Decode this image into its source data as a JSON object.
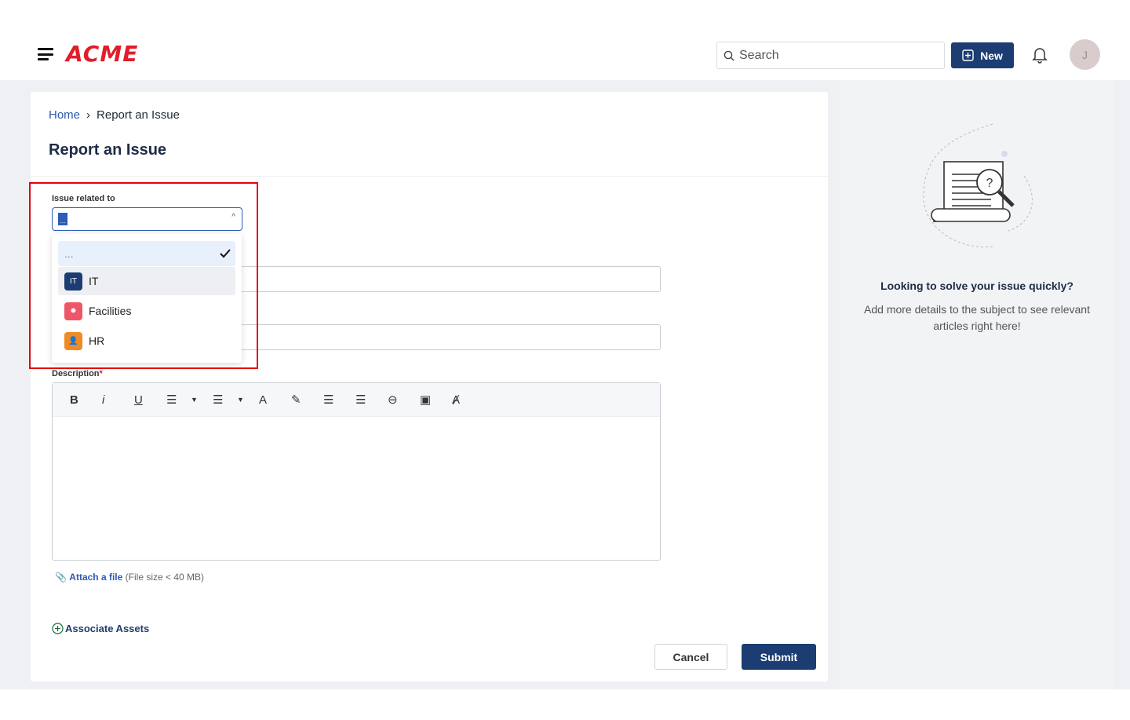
{
  "header": {
    "logo": "ACME",
    "search_placeholder": "Search",
    "new_label": "New",
    "avatar_initial": "J"
  },
  "breadcrumb": {
    "home": "Home",
    "separator": "›",
    "current": "Report an Issue"
  },
  "page_title": "Report an Issue",
  "form": {
    "issue_label": "Issue related to",
    "issue_value": "...",
    "options": [
      {
        "label": "...",
        "selected": true
      },
      {
        "label": "IT",
        "icon": "IT"
      },
      {
        "label": "Facilities",
        "icon": "wrench-gear-icon"
      },
      {
        "label": "HR",
        "icon": "id-card-icon"
      }
    ],
    "description_label": "Description",
    "required_mark": "*",
    "toolbar": [
      "B",
      "i",
      "U",
      "ordered-list",
      "▾",
      "bullet-list",
      "▾",
      "font-color",
      "highlight",
      "outdent",
      "indent",
      "link",
      "image",
      "clear-format"
    ],
    "attach_link": "Attach a file",
    "attach_hint": "(File size < 40 MB)",
    "associate_assets": "Associate Assets",
    "cancel": "Cancel",
    "submit": "Submit"
  },
  "side": {
    "heading": "Looking to solve your issue quickly?",
    "text": "Add more details to the subject to see relevant articles right here!"
  },
  "colors": {
    "brand": "#e11d2a",
    "primary": "#1b3d72",
    "highlight": "#e3000f"
  }
}
